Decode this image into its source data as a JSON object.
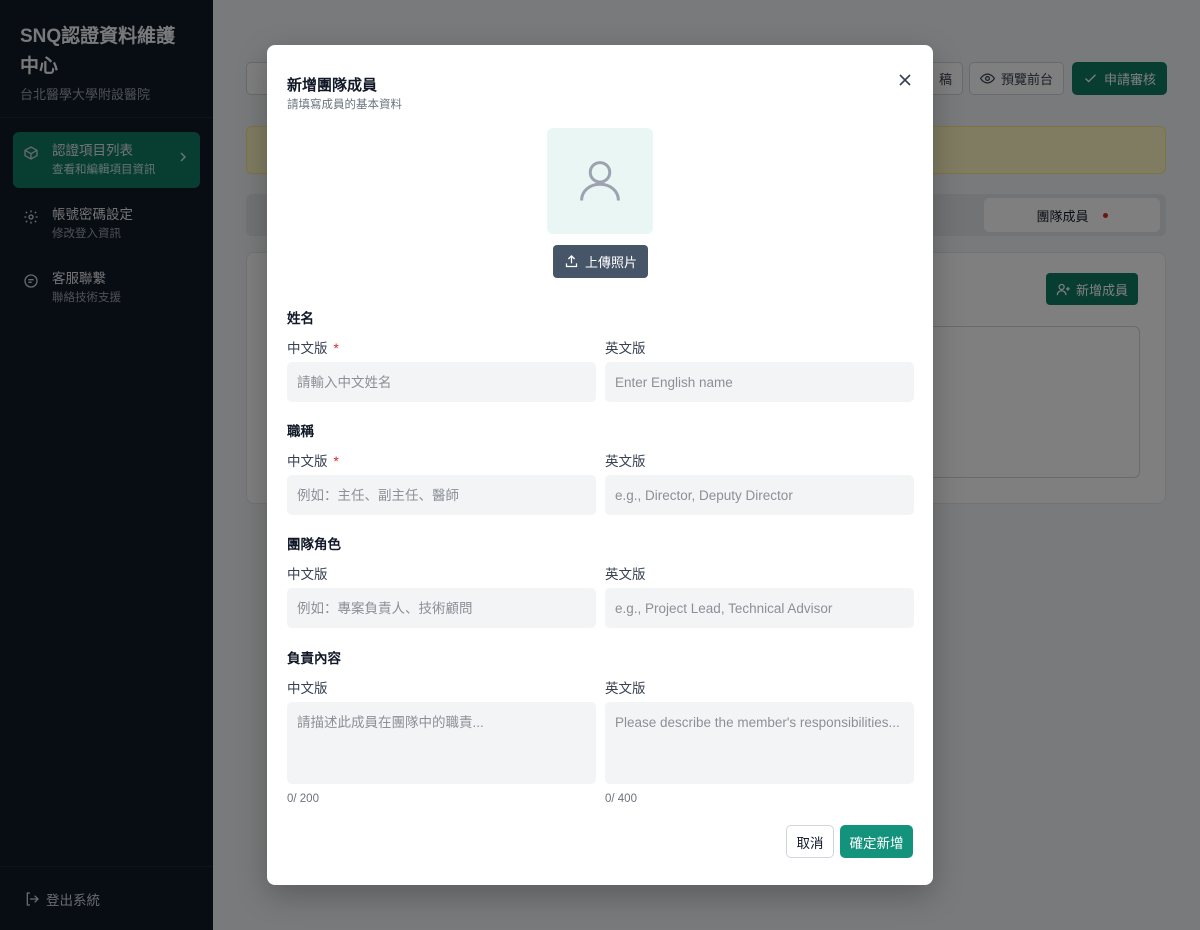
{
  "sidebar": {
    "title": "SNQ認證資料維護中心",
    "subtitle": "台北醫學大學附設醫院",
    "items": [
      {
        "label": "認證項目列表",
        "sub": "查看和編輯項目資訊",
        "icon": "package-icon"
      },
      {
        "label": "帳號密碼設定",
        "sub": "修改登入資訊",
        "icon": "gear-icon"
      },
      {
        "label": "客服聯繫",
        "sub": "聯絡技術支援",
        "icon": "message-icon"
      }
    ],
    "logout": "登出系統"
  },
  "toolbar": {
    "draft_label_fragment": "稿",
    "preview_label": "預覽前台",
    "submit_label": "申請審核"
  },
  "tabs": {
    "team_label": "團隊成員"
  },
  "card": {
    "add_member_label": "新增成員"
  },
  "modal": {
    "title": "新增團隊成員",
    "subtitle": "請填寫成員的基本資料",
    "upload_label": "上傳照片",
    "sections": {
      "name": {
        "title": "姓名",
        "zh_label": "中文版",
        "en_label": "英文版",
        "zh_placeholder": "請輸入中文姓名",
        "en_placeholder": "Enter English name"
      },
      "position": {
        "title": "職稱",
        "zh_label": "中文版",
        "en_label": "英文版",
        "zh_placeholder": "例如：主任、副主任、醫師",
        "en_placeholder": "e.g., Director, Deputy Director"
      },
      "role": {
        "title": "團隊角色",
        "zh_label": "中文版",
        "en_label": "英文版",
        "zh_placeholder": "例如：專案負責人、技術顧問",
        "en_placeholder": "e.g., Project Lead, Technical Advisor"
      },
      "duty": {
        "title": "負責內容",
        "zh_label": "中文版",
        "en_label": "英文版",
        "zh_placeholder": "請描述此成員在團隊中的職責...",
        "en_placeholder": "Please describe the member's responsibilities...",
        "zh_count": "0/ 200",
        "en_count": "0/ 400"
      }
    },
    "cancel_label": "取消",
    "confirm_label": "確定新增"
  },
  "colors": {
    "sidebar_bg": "#111827",
    "accent": "#117a65",
    "confirm": "#14937c",
    "upload": "#475569",
    "required": "#dc2626"
  }
}
